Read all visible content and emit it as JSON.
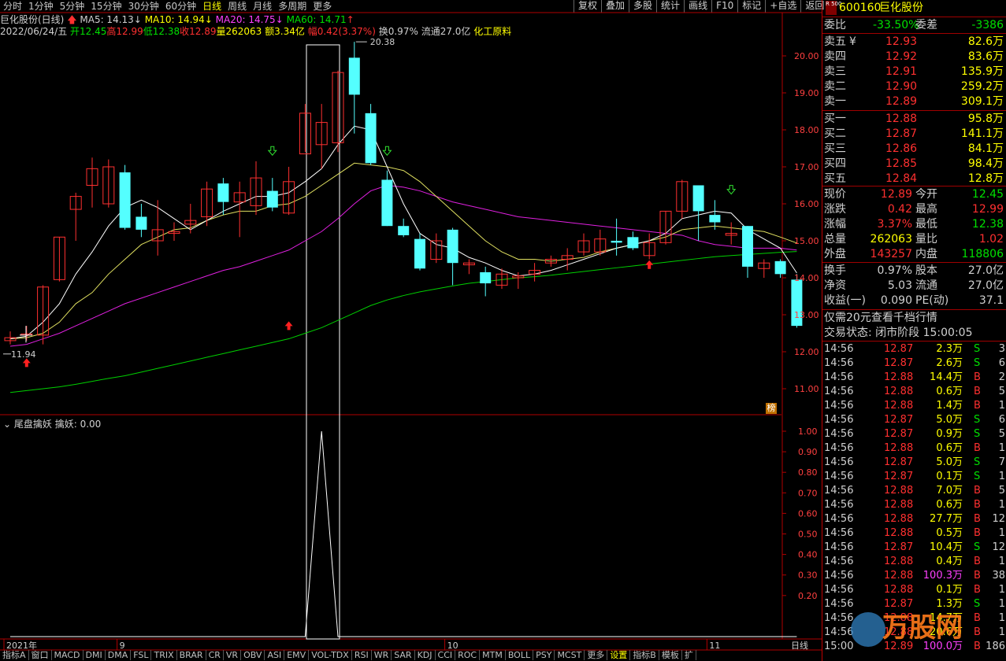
{
  "periods": [
    "分时",
    "1分钟",
    "5分钟",
    "15分钟",
    "30分钟",
    "60分钟",
    "日线",
    "周线",
    "月线",
    "多周期",
    "更多"
  ],
  "active_period": "日线",
  "top_buttons": [
    "复权",
    "叠加",
    "多股",
    "统计",
    "画线",
    "F10",
    "标记",
    "+自选",
    "返回"
  ],
  "header": {
    "stock_label": "巨化股份(日线)",
    "ma5": "MA5: 14.13",
    "ma10": "MA10: 14.94",
    "ma20": "MA20: 14.75",
    "ma60": "MA60: 14.71",
    "date": "2022/06/24/五",
    "open": "开12.45",
    "high": "高12.99",
    "low": "低12.38",
    "close": "收12.89",
    "volume": "量262063",
    "amount": "额3.34亿",
    "change": "幅0.42(3.37%)",
    "turnover": "换0.97%",
    "float": "流通27.0亿",
    "industry": "化工原料"
  },
  "price_axis": [
    "20.00",
    "19.00",
    "18.00",
    "17.00",
    "16.00",
    "15.00",
    "14.00",
    "13.00",
    "12.00",
    "11.00"
  ],
  "high_mark": "20.38",
  "low_mark": "11.94",
  "rank_badge": "榜",
  "indicator": {
    "name": "尾盘擒妖",
    "value_label": "擒妖: 0.00",
    "axis": [
      "1.00",
      "0.90",
      "0.80",
      "0.70",
      "0.60",
      "0.50",
      "0.40",
      "0.30",
      "0.20"
    ]
  },
  "time_axis": [
    "2021年",
    "9",
    "10",
    "11"
  ],
  "bottom_tabs": [
    "指标A",
    "窗口",
    "MACD",
    "DMI",
    "DMA",
    "FSL",
    "TRIX",
    "BRAR",
    "CR",
    "VR",
    "OBV",
    "ASI",
    "EMV",
    "VOL-TDX",
    "RSI",
    "WR",
    "SAR",
    "KDJ",
    "CCI",
    "ROC",
    "MTM",
    "BOLL",
    "PSY",
    "MCST",
    "更多",
    "设置",
    "指标B",
    "模板",
    "扩"
  ],
  "quote": {
    "badge": "R 500",
    "code": "600160",
    "name": "巨化股份",
    "weibi_label": "委比",
    "weibi": "-33.50%",
    "weicha_label": "委差",
    "weicha": "-3386",
    "asks": [
      {
        "label": "卖五",
        "mark": "¥",
        "price": "12.93",
        "vol": "82.6万"
      },
      {
        "label": "卖四",
        "mark": "",
        "price": "12.92",
        "vol": "83.6万"
      },
      {
        "label": "卖三",
        "mark": "",
        "price": "12.91",
        "vol": "135.9万"
      },
      {
        "label": "卖二",
        "mark": "",
        "price": "12.90",
        "vol": "259.2万"
      },
      {
        "label": "卖一",
        "mark": "",
        "price": "12.89",
        "vol": "309.1万"
      }
    ],
    "bids": [
      {
        "label": "买一",
        "price": "12.88",
        "vol": "95.8万"
      },
      {
        "label": "买二",
        "price": "12.87",
        "vol": "141.1万"
      },
      {
        "label": "买三",
        "price": "12.86",
        "vol": "84.1万"
      },
      {
        "label": "买四",
        "price": "12.85",
        "vol": "98.4万"
      },
      {
        "label": "买五",
        "price": "12.84",
        "vol": "12.8万"
      }
    ],
    "stats": [
      {
        "l1": "现价",
        "v1": "12.89",
        "l2": "今开",
        "v2": "12.45",
        "c1": "r",
        "c2": "g"
      },
      {
        "l1": "涨跌",
        "v1": "0.42",
        "l2": "最高",
        "v2": "12.99",
        "c1": "r",
        "c2": "r"
      },
      {
        "l1": "涨幅",
        "v1": "3.37%",
        "l2": "最低",
        "v2": "12.38",
        "c1": "r",
        "c2": "g"
      },
      {
        "l1": "总量",
        "v1": "262063",
        "l2": "量比",
        "v2": "1.02",
        "c1": "y",
        "c2": "r"
      },
      {
        "l1": "外盘",
        "v1": "143257",
        "l2": "内盘",
        "v2": "118806",
        "c1": "r",
        "c2": "g"
      }
    ],
    "stats2": [
      {
        "l1": "换手",
        "v1": "0.97%",
        "l2": "股本",
        "v2": "27.0亿"
      },
      {
        "l1": "净资",
        "v1": "5.03",
        "l2": "流通",
        "v2": "27.0亿"
      },
      {
        "l1": "收益(一)",
        "v1": "0.090",
        "l2": "PE(动)",
        "v2": "37.1"
      }
    ],
    "promo": "仅需20元查看千档行情",
    "trade_state": "交易状态: 闭市阶段 15:00:05",
    "ticks": [
      {
        "t": "14:56",
        "p": "12.87",
        "v": "2.3万",
        "s": "S",
        "n": "3"
      },
      {
        "t": "14:56",
        "p": "12.87",
        "v": "2.6万",
        "s": "S",
        "n": "6"
      },
      {
        "t": "14:56",
        "p": "12.88",
        "v": "14.4万",
        "s": "B",
        "n": "2"
      },
      {
        "t": "14:56",
        "p": "12.88",
        "v": "0.6万",
        "s": "B",
        "n": "5"
      },
      {
        "t": "14:56",
        "p": "12.88",
        "v": "1.4万",
        "s": "B",
        "n": "1"
      },
      {
        "t": "14:56",
        "p": "12.87",
        "v": "5.0万",
        "s": "S",
        "n": "6"
      },
      {
        "t": "14:56",
        "p": "12.87",
        "v": "0.9万",
        "s": "S",
        "n": "5"
      },
      {
        "t": "14:56",
        "p": "12.88",
        "v": "0.6万",
        "s": "B",
        "n": "1"
      },
      {
        "t": "14:56",
        "p": "12.87",
        "v": "5.0万",
        "s": "S",
        "n": "7"
      },
      {
        "t": "14:56",
        "p": "12.87",
        "v": "0.1万",
        "s": "S",
        "n": "1"
      },
      {
        "t": "14:56",
        "p": "12.88",
        "v": "7.0万",
        "s": "B",
        "n": "5"
      },
      {
        "t": "14:56",
        "p": "12.88",
        "v": "0.6万",
        "s": "B",
        "n": "1"
      },
      {
        "t": "14:56",
        "p": "12.88",
        "v": "27.7万",
        "s": "B",
        "n": "12"
      },
      {
        "t": "14:56",
        "p": "12.88",
        "v": "0.5万",
        "s": "B",
        "n": "1"
      },
      {
        "t": "14:56",
        "p": "12.87",
        "v": "10.4万",
        "s": "S",
        "n": "12"
      },
      {
        "t": "14:56",
        "p": "12.88",
        "v": "0.4万",
        "s": "B",
        "n": "1"
      },
      {
        "t": "14:56",
        "p": "12.88",
        "v": "100.3万",
        "s": "B",
        "n": "38"
      },
      {
        "t": "14:56",
        "p": "12.88",
        "v": "0.1万",
        "s": "B",
        "n": "1"
      },
      {
        "t": "14:56",
        "p": "12.87",
        "v": "1.3万",
        "s": "S",
        "n": "1"
      },
      {
        "t": "14:56",
        "p": "12.88",
        "v": "14.7万",
        "s": "B",
        "n": "1"
      },
      {
        "t": "14:56",
        "p": "12.88",
        "v": "20.6万",
        "s": "B",
        "n": "1"
      },
      {
        "t": "15:00",
        "p": "12.89",
        "v": "100.0万",
        "s": "B",
        "n": "186"
      }
    ]
  },
  "watermark": "万股网",
  "chart_data": {
    "type": "candlestick",
    "ylim": [
      10.5,
      20.8
    ],
    "candles": [
      {
        "o": 12.3,
        "c": 12.38,
        "h": 12.55,
        "l": 12.2
      },
      {
        "o": 12.45,
        "c": 12.48,
        "h": 12.7,
        "l": 12.3
      },
      {
        "o": 12.45,
        "c": 13.75,
        "h": 13.8,
        "l": 12.2
      },
      {
        "o": 13.95,
        "c": 15.1,
        "h": 15.1,
        "l": 13.9
      },
      {
        "o": 15.85,
        "c": 16.2,
        "h": 16.3,
        "l": 15.0
      },
      {
        "o": 16.5,
        "c": 16.95,
        "h": 17.25,
        "l": 15.9
      },
      {
        "o": 16.0,
        "c": 17.0,
        "h": 17.2,
        "l": 15.9
      },
      {
        "o": 16.85,
        "c": 15.35,
        "h": 17.05,
        "l": 15.3
      },
      {
        "o": 15.65,
        "c": 15.3,
        "h": 16.0,
        "l": 15.1
      },
      {
        "o": 15.0,
        "c": 15.3,
        "h": 16.1,
        "l": 14.6
      },
      {
        "o": 15.2,
        "c": 15.25,
        "h": 15.5,
        "l": 15.0
      },
      {
        "o": 15.45,
        "c": 15.55,
        "h": 16.0,
        "l": 15.2
      },
      {
        "o": 15.65,
        "c": 16.4,
        "h": 16.6,
        "l": 15.4
      },
      {
        "o": 16.55,
        "c": 16.05,
        "h": 16.7,
        "l": 15.7
      },
      {
        "o": 16.05,
        "c": 16.3,
        "h": 16.6,
        "l": 15.1
      },
      {
        "o": 15.95,
        "c": 16.7,
        "h": 17.15,
        "l": 15.7
      },
      {
        "o": 16.35,
        "c": 15.9,
        "h": 16.7,
        "l": 15.8
      },
      {
        "o": 15.75,
        "c": 16.6,
        "h": 17.0,
        "l": 15.7
      },
      {
        "o": 17.35,
        "c": 18.45,
        "h": 18.7,
        "l": 17.4
      },
      {
        "o": 17.6,
        "c": 18.2,
        "h": 18.7,
        "l": 16.95
      },
      {
        "o": 17.65,
        "c": 19.55,
        "h": 19.6,
        "l": 17.4
      },
      {
        "o": 19.95,
        "c": 18.95,
        "h": 20.38,
        "l": 17.9
      },
      {
        "o": 18.45,
        "c": 17.1,
        "h": 18.7,
        "l": 17.05
      },
      {
        "o": 16.65,
        "c": 15.4,
        "h": 16.9,
        "l": 15.4
      },
      {
        "o": 15.4,
        "c": 15.15,
        "h": 15.6,
        "l": 15.1
      },
      {
        "o": 15.05,
        "c": 14.25,
        "h": 15.2,
        "l": 14.2
      },
      {
        "o": 14.5,
        "c": 15.0,
        "h": 15.2,
        "l": 14.4
      },
      {
        "o": 15.3,
        "c": 14.4,
        "h": 15.35,
        "l": 13.8
      },
      {
        "o": 14.35,
        "c": 14.4,
        "h": 14.5,
        "l": 14.1
      },
      {
        "o": 14.15,
        "c": 13.85,
        "h": 14.3,
        "l": 13.5
      },
      {
        "o": 13.8,
        "c": 14.1,
        "h": 14.25,
        "l": 13.7
      },
      {
        "o": 14.0,
        "c": 14.05,
        "h": 14.15,
        "l": 13.7
      },
      {
        "o": 14.1,
        "c": 14.2,
        "h": 14.4,
        "l": 13.9
      },
      {
        "o": 14.4,
        "c": 14.5,
        "h": 14.6,
        "l": 14.3
      },
      {
        "o": 14.5,
        "c": 14.6,
        "h": 14.8,
        "l": 14.2
      },
      {
        "o": 14.7,
        "c": 15.0,
        "h": 15.2,
        "l": 14.6
      },
      {
        "o": 14.7,
        "c": 15.05,
        "h": 15.3,
        "l": 14.6
      },
      {
        "o": 15.0,
        "c": 14.95,
        "h": 15.6,
        "l": 14.6
      },
      {
        "o": 15.1,
        "c": 14.8,
        "h": 15.25,
        "l": 14.75
      },
      {
        "o": 14.6,
        "c": 14.95,
        "h": 15.2,
        "l": 14.5
      },
      {
        "o": 14.95,
        "c": 15.8,
        "h": 15.8,
        "l": 14.9
      },
      {
        "o": 15.8,
        "c": 16.6,
        "h": 16.65,
        "l": 15.6
      },
      {
        "o": 16.5,
        "c": 15.8,
        "h": 16.5,
        "l": 15.0
      },
      {
        "o": 15.7,
        "c": 15.5,
        "h": 16.1,
        "l": 15.3
      },
      {
        "o": 15.15,
        "c": 15.2,
        "h": 15.5,
        "l": 14.9
      },
      {
        "o": 15.4,
        "c": 14.3,
        "h": 15.4,
        "l": 14.0
      },
      {
        "o": 14.25,
        "c": 14.4,
        "h": 14.5,
        "l": 14.0
      },
      {
        "o": 14.45,
        "c": 14.1,
        "h": 14.5,
        "l": 14.0
      },
      {
        "o": 13.95,
        "c": 12.7,
        "h": 14.1,
        "l": 12.65
      }
    ],
    "ma5": [
      12.35,
      12.42,
      12.8,
      13.3,
      14.1,
      14.7,
      15.4,
      15.9,
      16.1,
      15.9,
      15.6,
      15.3,
      15.55,
      15.8,
      16.0,
      16.2,
      16.2,
      16.3,
      16.6,
      16.95,
      17.6,
      18.1,
      18.0,
      17.0,
      16.0,
      15.2,
      14.9,
      14.8,
      14.55,
      14.4,
      14.2,
      14.05,
      14.1,
      14.2,
      14.35,
      14.5,
      14.65,
      14.8,
      14.9,
      15.0,
      15.2,
      15.6,
      15.7,
      15.8,
      15.75,
      15.3,
      15.05,
      14.8,
      14.13
    ],
    "ma10": [
      12.35,
      12.38,
      12.5,
      12.8,
      13.3,
      13.6,
      14.1,
      14.5,
      14.9,
      15.1,
      15.3,
      15.35,
      15.55,
      15.7,
      15.8,
      15.8,
      15.95,
      16.0,
      16.2,
      16.5,
      16.8,
      17.1,
      17.05,
      17.0,
      16.9,
      16.6,
      16.2,
      15.8,
      15.4,
      15.0,
      14.7,
      14.5,
      14.5,
      14.45,
      14.5,
      14.55,
      14.7,
      14.8,
      14.9,
      15.0,
      15.1,
      15.3,
      15.35,
      15.4,
      15.35,
      15.3,
      15.25,
      15.1,
      14.94
    ],
    "ma20": [
      12.15,
      12.2,
      12.35,
      12.5,
      12.7,
      12.9,
      13.1,
      13.3,
      13.45,
      13.6,
      13.75,
      13.9,
      14.05,
      14.2,
      14.3,
      14.45,
      14.6,
      14.75,
      15.0,
      15.25,
      15.6,
      16.0,
      16.35,
      16.5,
      16.45,
      16.35,
      16.2,
      16.05,
      15.95,
      15.85,
      15.75,
      15.65,
      15.6,
      15.55,
      15.5,
      15.45,
      15.4,
      15.35,
      15.3,
      15.25,
      15.2,
      15.15,
      15.0,
      14.9,
      14.85,
      14.8,
      14.8,
      14.8,
      14.75
    ],
    "ma60": [
      10.9,
      10.95,
      11.0,
      11.05,
      11.12,
      11.2,
      11.28,
      11.35,
      11.45,
      11.55,
      11.65,
      11.75,
      11.85,
      11.95,
      12.05,
      12.15,
      12.25,
      12.35,
      12.5,
      12.65,
      12.85,
      13.05,
      13.25,
      13.4,
      13.52,
      13.62,
      13.7,
      13.78,
      13.85,
      13.9,
      13.95,
      14.0,
      14.03,
      14.07,
      14.12,
      14.17,
      14.22,
      14.27,
      14.32,
      14.37,
      14.42,
      14.47,
      14.52,
      14.57,
      14.6,
      14.63,
      14.66,
      14.69,
      14.71
    ],
    "indicator_values": [
      0,
      0,
      0,
      0,
      0,
      0,
      0,
      0,
      0,
      0,
      0,
      0,
      0,
      0,
      0,
      0,
      0,
      0,
      0,
      1,
      0,
      0,
      0,
      0,
      0,
      0,
      0,
      0,
      0,
      0,
      0,
      0,
      0,
      0,
      0,
      0,
      0,
      0,
      0,
      0,
      0,
      0,
      0,
      0,
      0,
      0,
      0,
      0,
      0
    ]
  }
}
